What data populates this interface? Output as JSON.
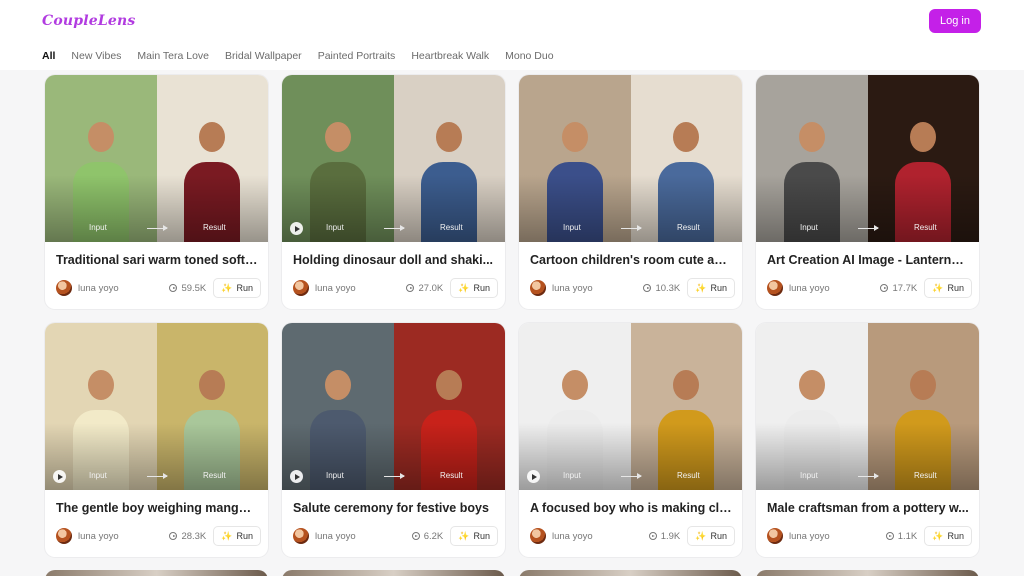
{
  "app": {
    "logo": "CoupleLens",
    "login_label": "Log in"
  },
  "tabs": [
    {
      "label": "All",
      "active": true
    },
    {
      "label": "New Vibes",
      "active": false
    },
    {
      "label": "Main Tera Love",
      "active": false
    },
    {
      "label": "Bridal Wallpaper",
      "active": false
    },
    {
      "label": "Painted Portraits",
      "active": false
    },
    {
      "label": "Heartbreak Walk",
      "active": false
    },
    {
      "label": "Mono Duo",
      "active": false
    }
  ],
  "labels": {
    "input": "Input",
    "result": "Result",
    "run": "Run"
  },
  "cards": [
    {
      "title": "Traditional sari warm toned soft l...",
      "author": "luna yoyo",
      "views": "59.5K",
      "video": false,
      "colors": [
        "#9ab87a",
        "#e9e2d4",
        "#8fc46b",
        "#7a1a22"
      ]
    },
    {
      "title": "Holding dinosaur doll and shaki...",
      "author": "luna yoyo",
      "views": "27.0K",
      "video": true,
      "colors": [
        "#6f8f5a",
        "#d9d0c4",
        "#5a6e3e",
        "#3c5d8f"
      ]
    },
    {
      "title": "Cartoon children's room cute an...",
      "author": "luna yoyo",
      "views": "10.3K",
      "video": false,
      "colors": [
        "#b9a58d",
        "#e6ddd0",
        "#3b4f8a",
        "#4a6a9c"
      ]
    },
    {
      "title": "Art Creation AI Image - Lanterns ...",
      "author": "luna yoyo",
      "views": "17.7K",
      "video": false,
      "colors": [
        "#a7a39c",
        "#2b1a12",
        "#4a4a4a",
        "#b0222e"
      ]
    },
    {
      "title": "The gentle boy weighing mangoes",
      "author": "luna yoyo",
      "views": "28.3K",
      "video": true,
      "colors": [
        "#e3d6b4",
        "#c9b56a",
        "#f2eac8",
        "#a9c79a"
      ]
    },
    {
      "title": "Salute ceremony for festive boys",
      "author": "luna yoyo",
      "views": "6.2K",
      "video": true,
      "colors": [
        "#5e6a70",
        "#9c2a22",
        "#4d5a6e",
        "#c8221a"
      ]
    },
    {
      "title": "A focused boy who is making cla...",
      "author": "luna yoyo",
      "views": "1.9K",
      "video": true,
      "colors": [
        "#efefef",
        "#c9b39a",
        "#ececec",
        "#d19a1c"
      ]
    },
    {
      "title": "Male craftsman from a pottery w...",
      "author": "luna yoyo",
      "views": "1.1K",
      "video": false,
      "colors": [
        "#efefef",
        "#b89a7c",
        "#ececec",
        "#d19a1c"
      ]
    }
  ]
}
